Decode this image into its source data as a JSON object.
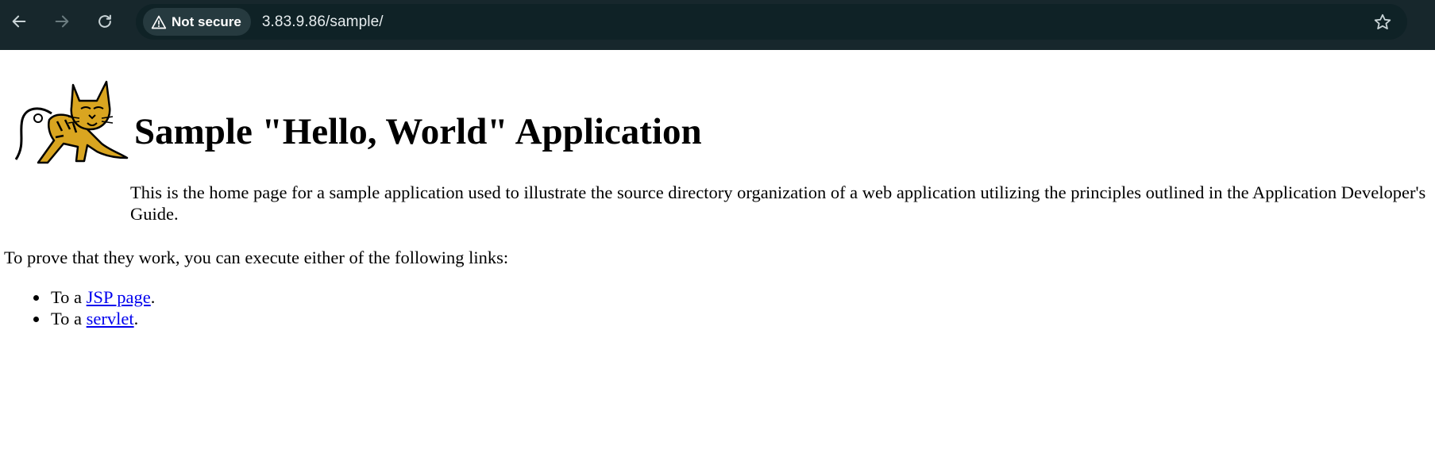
{
  "browser": {
    "back_icon": "arrow-left-icon",
    "forward_icon": "arrow-right-icon",
    "reload_icon": "reload-icon",
    "security_label": "Not secure",
    "security_icon": "warning-triangle-icon",
    "url": "3.83.9.86/sample/",
    "bookmark_icon": "star-icon"
  },
  "page": {
    "logo": "tomcat-logo",
    "title": "Sample \"Hello, World\" Application",
    "intro": "This is the home page for a sample application used to illustrate the source directory organization of a web application utilizing the principles outlined in the Application Developer's Guide.",
    "prove_text": "To prove that they work, you can execute either of the following links:",
    "links": [
      {
        "prefix": "To a ",
        "link_text": "JSP page",
        "suffix": "."
      },
      {
        "prefix": "To a ",
        "link_text": "servlet",
        "suffix": "."
      }
    ]
  },
  "colors": {
    "toolbar_bg": "#17272c",
    "omnibox_bg": "#0f2226",
    "link": "#0000ee"
  }
}
